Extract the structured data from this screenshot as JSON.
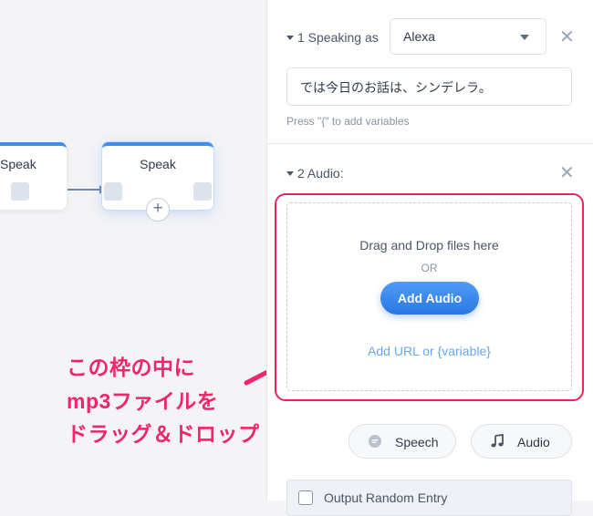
{
  "canvas": {
    "left_node_title": "Speak",
    "main_node_title": "Speak",
    "plus_symbol": "+",
    "annotation_lines": [
      "この枠の中に",
      "mp3ファイルを",
      "ドラッグ＆ドロップ"
    ],
    "annotation_color": "#f0256b"
  },
  "panel": {
    "step1": {
      "label": "1 Speaking as",
      "voice_value": "Alexa",
      "text_value": "では今日のお話は、シンデレラ。",
      "hint": "Press \"{\" to add variables",
      "close_symbol": "✕"
    },
    "step2": {
      "label": "2  Audio:",
      "close_symbol": "✕",
      "drop_title": "Drag and Drop files here",
      "drop_or": "OR",
      "add_audio_label": "Add Audio",
      "add_url_label": "Add URL or {variable}"
    },
    "buttons": {
      "speech_label": "Speech",
      "audio_label": "Audio",
      "speech_icon": "speech-bubble-icon",
      "audio_icon": "music-note-icon"
    },
    "output_random_label": "Output Random Entry"
  },
  "colors": {
    "accent": "#3d8ef0",
    "highlight": "#e8255f"
  }
}
